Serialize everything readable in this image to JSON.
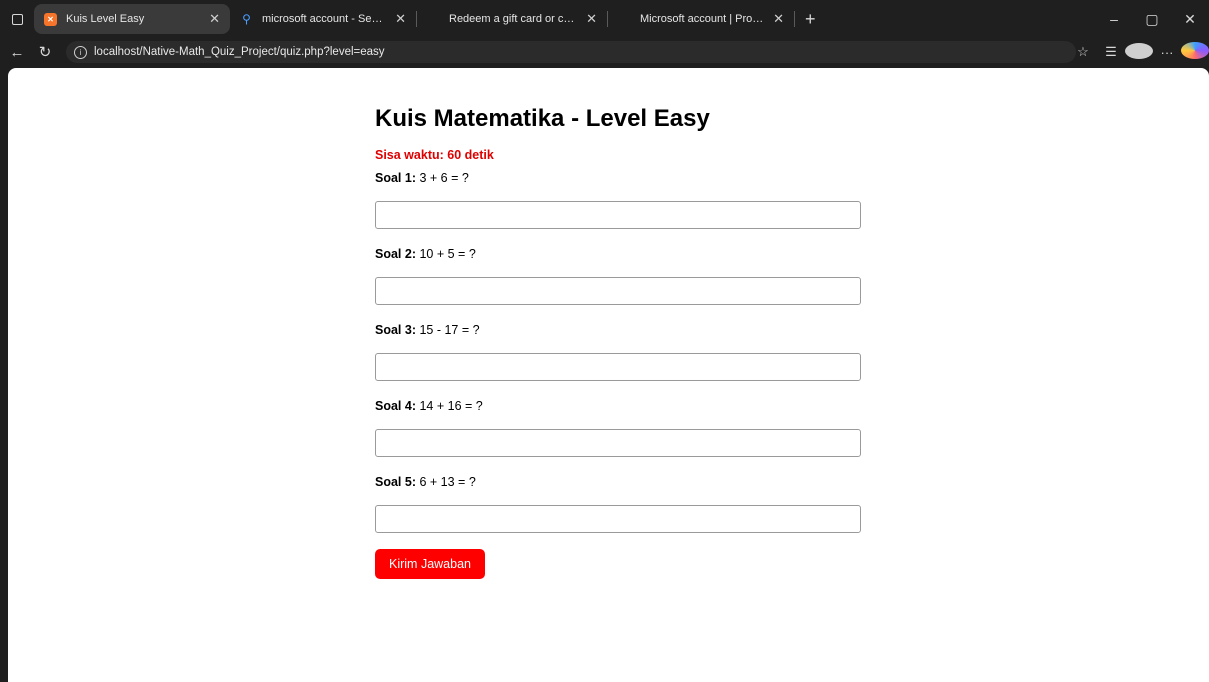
{
  "browser": {
    "tabs": [
      {
        "title": "Kuis Level Easy",
        "icon": "xampp-icon",
        "active": true
      },
      {
        "title": "microsoft account - Search",
        "icon": "search-icon",
        "active": false
      },
      {
        "title": "Redeem a gift card or code to yo",
        "icon": "microsoft-icon",
        "active": false
      },
      {
        "title": "Microsoft account | Profil Anda",
        "icon": "microsoft-icon",
        "active": false
      }
    ],
    "url": "localhost/Native-Math_Quiz_Project/quiz.php?level=easy"
  },
  "page": {
    "title": "Kuis Matematika - Level Easy",
    "timer": "Sisa waktu: 60 detik",
    "questions": [
      {
        "label": "Soal 1:",
        "text": " 3 + 6 = ?",
        "value": ""
      },
      {
        "label": "Soal 2:",
        "text": " 10 + 5 = ?",
        "value": ""
      },
      {
        "label": "Soal 3:",
        "text": " 15 - 17 = ?",
        "value": ""
      },
      {
        "label": "Soal 4:",
        "text": " 14 + 16 = ?",
        "value": ""
      },
      {
        "label": "Soal 5:",
        "text": " 6 + 13 = ?",
        "value": ""
      }
    ],
    "submit_label": "Kirim Jawaban"
  },
  "colors": {
    "accent": "#ff0000",
    "timer": "#e00000",
    "chrome_bg": "#1f1f1f"
  }
}
